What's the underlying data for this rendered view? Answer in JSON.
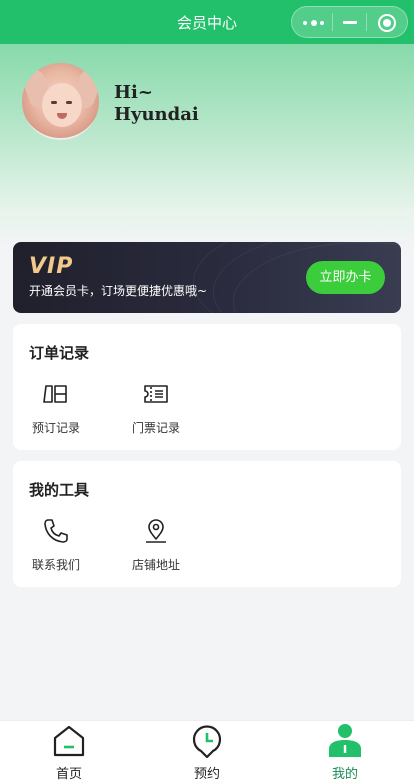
{
  "nav": {
    "title": "会员中心"
  },
  "profile": {
    "greeting": "Hi~",
    "name": "Hyundai"
  },
  "vip": {
    "badge": "VIP",
    "text": "开通会员卡，订场更便捷优惠哦~",
    "button": "立即办卡"
  },
  "orders": {
    "title": "订单记录",
    "items": [
      {
        "label": "预订记录",
        "icon": "book-icon"
      },
      {
        "label": "门票记录",
        "icon": "ticket-icon"
      }
    ]
  },
  "tools": {
    "title": "我的工具",
    "items": [
      {
        "label": "联系我们",
        "icon": "phone-icon"
      },
      {
        "label": "店铺地址",
        "icon": "location-icon"
      }
    ]
  },
  "tabbar": {
    "items": [
      {
        "label": "首页",
        "icon": "home-icon"
      },
      {
        "label": "预约",
        "icon": "clock-pin-icon"
      },
      {
        "label": "我的",
        "icon": "user-icon",
        "active": true
      }
    ]
  },
  "colors": {
    "primary": "#22c06a",
    "vip_gold": "#f2c98a",
    "vip_button": "#3ccd3c",
    "active_tab": "#1a8c53"
  }
}
